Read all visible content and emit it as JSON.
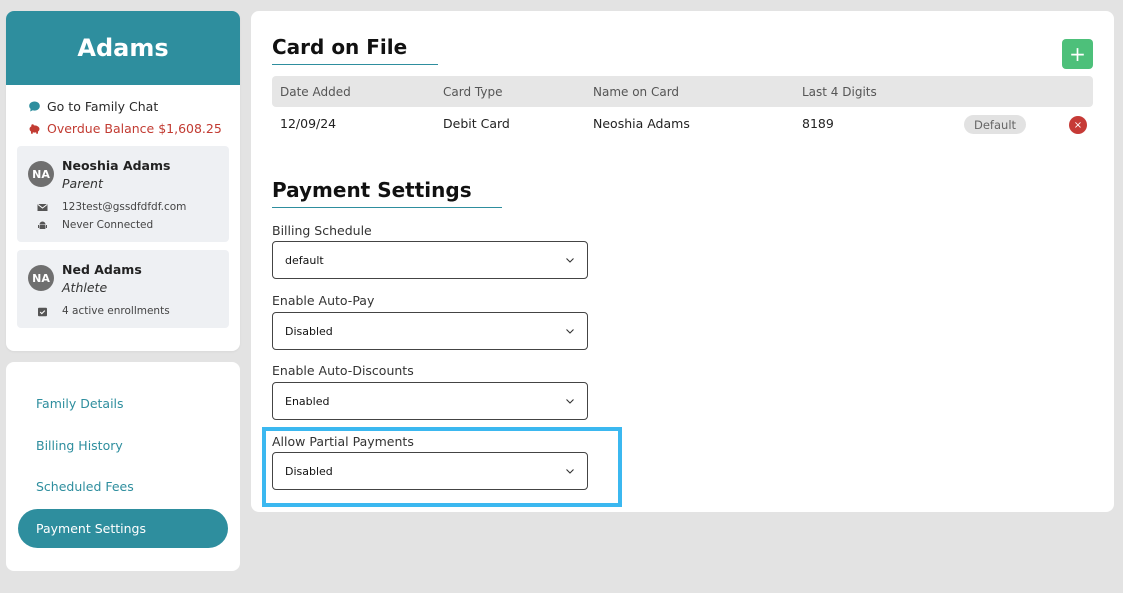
{
  "family": {
    "name": "Adams",
    "chat_link": "Go to Family Chat",
    "overdue_label": "Overdue Balance $1,608.25",
    "members": [
      {
        "initials": "NA",
        "name": "Neoshia Adams",
        "role": "Parent",
        "email": "123test@gssdfdfdf.com",
        "connection": "Never Connected"
      },
      {
        "initials": "NA",
        "name": "Ned Adams",
        "role": "Athlete",
        "enrollments": "4 active enrollments"
      }
    ]
  },
  "nav": {
    "items": [
      "Family Details",
      "Billing History",
      "Scheduled Fees",
      "Payment Settings"
    ],
    "active": "Payment Settings"
  },
  "card_on_file": {
    "title": "Card on File",
    "add_label": "+",
    "columns": [
      "Date Added",
      "Card Type",
      "Name on Card",
      "Last 4 Digits"
    ],
    "rows": [
      {
        "date_added": "12/09/24",
        "card_type": "Debit Card",
        "name_on_card": "Neoshia Adams",
        "last4": "8189",
        "badge": "Default",
        "remove_label": "×"
      }
    ]
  },
  "payment_settings": {
    "title": "Payment Settings",
    "fields": [
      {
        "label": "Billing Schedule",
        "value": "default"
      },
      {
        "label": "Enable Auto-Pay",
        "value": "Disabled"
      },
      {
        "label": "Enable Auto-Discounts",
        "value": "Enabled"
      },
      {
        "label": "Allow Partial Payments",
        "value": "Disabled"
      }
    ]
  },
  "colors": {
    "brand": "#2e8e9e",
    "overdue": "#c23b32",
    "add": "#4dc07a",
    "remove": "#c63a36",
    "highlight": "#3bb8f0"
  }
}
